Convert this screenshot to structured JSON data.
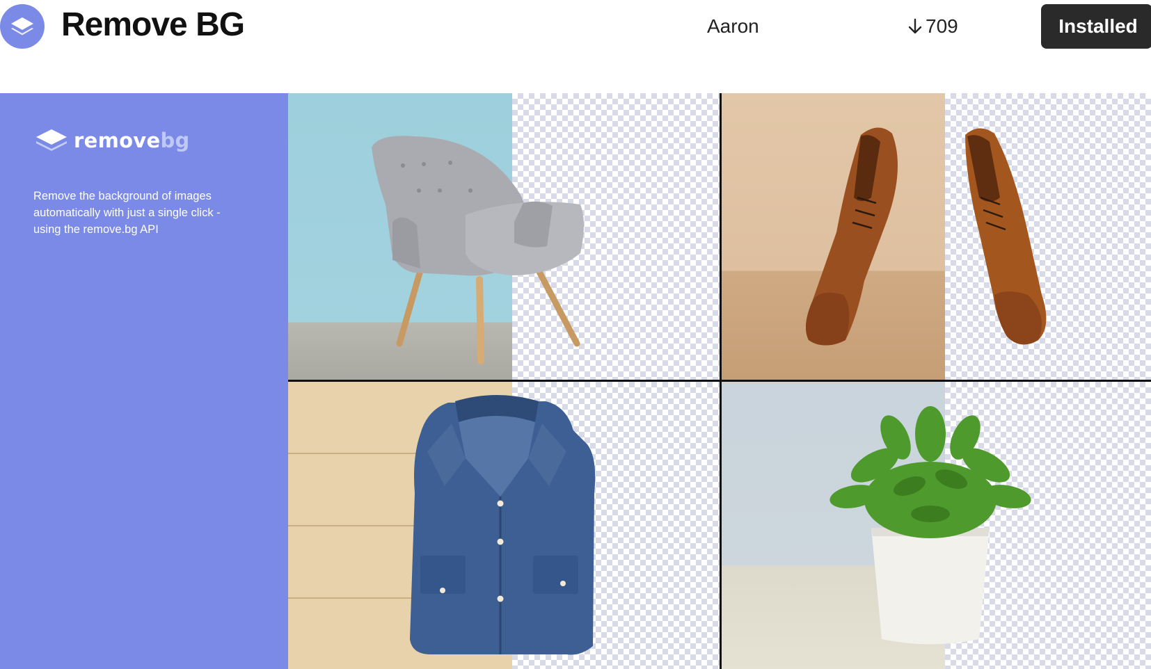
{
  "header": {
    "app_icon": "layers-icon",
    "title": "Remove BG",
    "author": "Aaron",
    "download_icon": "arrow-down-icon",
    "downloads": "709",
    "install_button": "Installed"
  },
  "banner": {
    "logo_icon": "removebg-layers-icon",
    "logo_text_primary": "remove",
    "logo_text_secondary": "bg",
    "description": "Remove the background of images automatically with just a single click - using the remove.bg API",
    "tiles": [
      "armchair",
      "shoes",
      "denim-shirt",
      "potted-plant"
    ]
  },
  "colors": {
    "accent": "#7b8ae6",
    "button_bg": "#2a2a2a"
  }
}
